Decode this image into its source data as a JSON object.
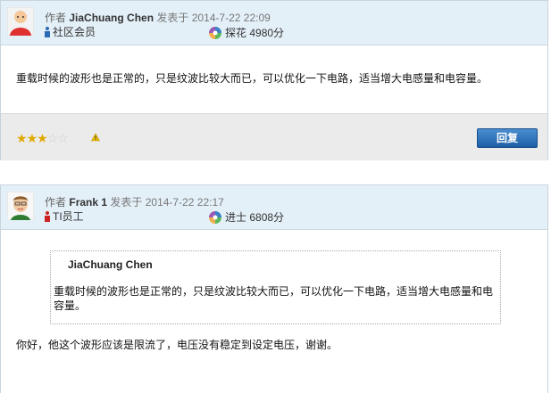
{
  "posts": [
    {
      "author_prefix": "作者",
      "author": "JiaChuang Chen",
      "posted_at": "发表于 2014-7-22 22:09",
      "role": "社区会员",
      "rank_title": "探花",
      "points": "4980分",
      "content": "重载时候的波形也是正常的，只是纹波比较大而已，可以优化一下电路，适当增大电感量和电容量。",
      "rating": 3,
      "rating_max": 5,
      "reply_label": "回复"
    },
    {
      "author_prefix": "作者",
      "author": "Frank 1",
      "posted_at": "发表于 2014-7-22 22:17",
      "role": "TI员工",
      "rank_title": "进士",
      "points": "6808分",
      "quote_author": "JiaChuang Chen",
      "quote_text": "重载时候的波形也是正常的，只是纹波比较大而已，可以优化一下电路，适当增大电感量和电容量。",
      "content": "你好，他这个波形应该是限流了，电压没有稳定到设定电压，谢谢。"
    }
  ],
  "colors": {
    "header_bg": "#e4f0f8",
    "reply_button": "#2a6db5",
    "star_on": "#e0a800",
    "member_icon": "#2a6ab7",
    "ti_icon": "#cc2222"
  }
}
